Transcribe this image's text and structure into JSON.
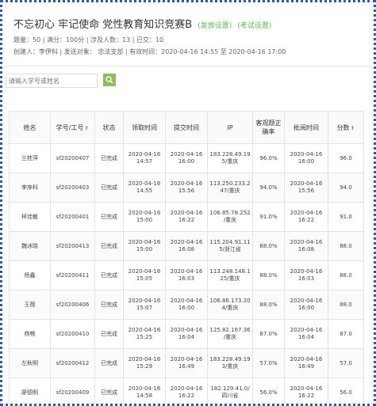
{
  "exam": {
    "title": "不忘初心 牢记使命 党性教育知识竞赛B",
    "publish_link": "(发放设置)",
    "exam_link": "(考试设置)",
    "meta_line1": "题量：50 | 满分：100分 | 涉及人数：13 | 已交：10",
    "meta_line2": "创建人：李伊科 | 发送对象： 忠法支部 | 有效时间：2020-04-16 14:55 至 2020-04-16 17:00"
  },
  "search": {
    "placeholder": "请输入学号或姓名"
  },
  "table": {
    "headers": {
      "name": "姓名",
      "id": "学号/工号",
      "status": "状态",
      "receive_time": "领取时间",
      "submit_time": "提交时间",
      "ip": "IP",
      "accuracy_a": "客观题正",
      "accuracy_b": "确率",
      "review_time": "批阅时间",
      "score": "分数"
    },
    "rows": [
      {
        "name": "兰桂萍",
        "id": "sf20200407",
        "status": "已完成",
        "recv_d": "2020-04-16",
        "recv_t": "14:57",
        "sub_d": "2020-04-16",
        "sub_t": "16:00",
        "ip_a": "183.228.49.19",
        "ip_b": "5/重庆",
        "acc": "96.0%",
        "rev_d": "2020-04-16",
        "rev_t": "16:00",
        "score": "96.0"
      },
      {
        "name": "李序科",
        "id": "sf20200403",
        "status": "已完成",
        "recv_d": "2020-04-16",
        "recv_t": "14:55",
        "sub_d": "2020-04-16",
        "sub_t": "15:56",
        "ip_a": "113.250.233.2",
        "ip_b": "47/重庆",
        "acc": "94.0%",
        "rev_d": "2020-04-16",
        "rev_t": "15:56",
        "score": "94.0"
      },
      {
        "name": "柯佳敏",
        "id": "sf20200401",
        "status": "已完成",
        "recv_d": "2020-04-16",
        "recv_t": "15:00",
        "sub_d": "2020-04-16",
        "sub_t": "16:22",
        "ip_a": "106.85.78.252",
        "ip_b": "/重庆",
        "acc": "91.0%",
        "rev_d": "2020-04-16",
        "rev_t": "16:22",
        "score": "91.0"
      },
      {
        "name": "魏冰晓",
        "id": "sf20200413",
        "status": "已完成",
        "recv_d": "2020-04-16",
        "recv_t": "15:00",
        "sub_d": "2020-04-16",
        "sub_t": "16:08",
        "ip_a": "115.204.91.11",
        "ip_b": "5/浙江省",
        "acc": "88.0%",
        "rev_d": "2020-04-16",
        "rev_t": "16:08",
        "score": "88.0"
      },
      {
        "name": "杨鑫",
        "id": "sf20200411",
        "status": "已完成",
        "recv_d": "2020-04-16",
        "recv_t": "15:05",
        "sub_d": "2020-04-16",
        "sub_t": "16:03",
        "ip_a": "113.248.148.1",
        "ip_b": "25/重庆",
        "acc": "88.0%",
        "rev_d": "2020-04-16",
        "rev_t": "16:03",
        "score": "88.0"
      },
      {
        "name": "王薇",
        "id": "sf20200406",
        "status": "已完成",
        "recv_d": "2020-04-16",
        "recv_t": "15:07",
        "sub_d": "2020-04-16",
        "sub_t": "16:00",
        "ip_a": "106.86.173.20",
        "ip_b": "4/重庆",
        "acc": "88.0%",
        "rev_d": "2020-04-16",
        "rev_t": "16:00",
        "score": "88.0"
      },
      {
        "name": "杨畅",
        "id": "sf20200410",
        "status": "已完成",
        "recv_d": "2020-04-16",
        "recv_t": "15:25",
        "sub_d": "2020-04-16",
        "sub_t": "16:04",
        "ip_a": "125.82.167.36",
        "ip_b": "/重庆",
        "acc": "87.0%",
        "rev_d": "2020-04-16",
        "rev_t": "16:04",
        "score": "87.0"
      },
      {
        "name": "左秋明",
        "id": "sf20200412",
        "status": "已完成",
        "recv_d": "2020-04-16",
        "recv_t": "15:29",
        "sub_d": "2020-04-16",
        "sub_t": "16:49",
        "ip_a": "183.228.49.19",
        "ip_b": "3/重庆",
        "acc": "57.0%",
        "rev_d": "2020-04-16",
        "rev_t": "16:49",
        "score": "57.0"
      },
      {
        "name": "廖德明",
        "id": "sf20200409",
        "status": "已完成",
        "recv_d": "2020-04-16",
        "recv_t": "14:58",
        "sub_d": "2020-04-16",
        "sub_t": "16:22",
        "ip_a": "182.129.41.0/",
        "ip_b": "四川省",
        "acc": "56.0%",
        "rev_d": "2020-04-16",
        "rev_t": "16:22",
        "score": "56.0"
      }
    ]
  },
  "colors": {
    "accent_green": "#5cb85c",
    "search_button": "#8fbc5a",
    "frame_border": "#2b5aa6"
  }
}
